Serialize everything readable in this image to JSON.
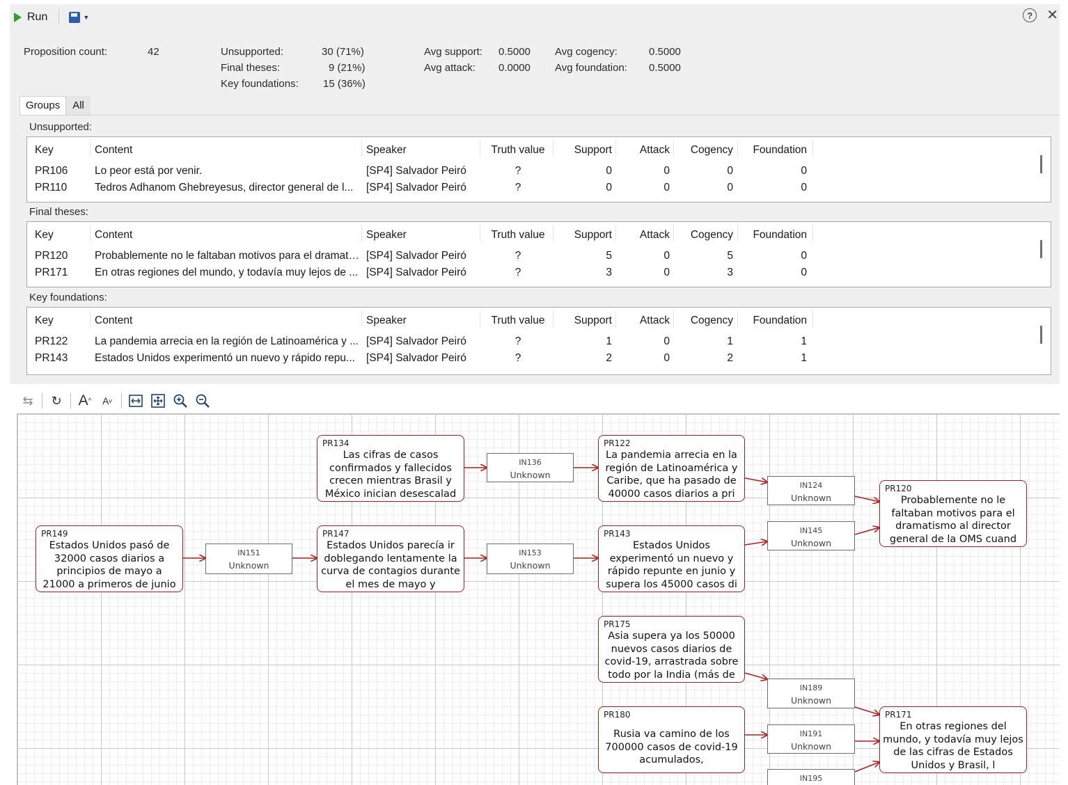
{
  "toolbar": {
    "run_label": "Run"
  },
  "stats": {
    "proposition_count_label": "Proposition count:",
    "proposition_count_value": "42",
    "unsupported_label": "Unsupported:",
    "unsupported_value": "30 (71%)",
    "final_theses_label": "Final theses:",
    "final_theses_value": "9 (21%)",
    "key_foundations_label": "Key foundations:",
    "key_foundations_value": "15 (36%)",
    "avg_support_label": "Avg support:",
    "avg_support_value": "0.5000",
    "avg_attack_label": "Avg attack:",
    "avg_attack_value": "0.0000",
    "avg_cogency_label": "Avg cogency:",
    "avg_cogency_value": "0.5000",
    "avg_foundation_label": "Avg foundation:",
    "avg_foundation_value": "0.5000"
  },
  "tabs": [
    {
      "label": "Groups"
    },
    {
      "label": "All"
    }
  ],
  "columns": [
    "Key",
    "Content",
    "Speaker",
    "Truth value",
    "Support",
    "Attack",
    "Cogency",
    "Foundation"
  ],
  "groups": {
    "unsupported": {
      "label": "Unsupported:",
      "rows": [
        [
          "PR106",
          "Lo peor está por venir.",
          "[SP4] Salvador Peiró",
          "?",
          "0",
          "0",
          "0",
          "0"
        ],
        [
          "PR110",
          "Tedros Adhanom Ghebreyesus, director general de l...",
          "[SP4] Salvador Peiró",
          "?",
          "0",
          "0",
          "0",
          "0"
        ]
      ]
    },
    "final_theses": {
      "label": "Final theses:",
      "rows": [
        [
          "PR120",
          "Probablemente no le faltaban motivos para el dramati...",
          "[SP4] Salvador Peiró",
          "?",
          "5",
          "0",
          "5",
          "0"
        ],
        [
          "PR171",
          "En otras regiones del mundo, y todavía muy lejos de ...",
          "[SP4] Salvador Peiró",
          "?",
          "3",
          "0",
          "3",
          "0"
        ]
      ]
    },
    "key_foundations": {
      "label": "Key foundations:",
      "rows": [
        [
          "PR122",
          "La pandemia arrecia en la región de Latinoamérica y ...",
          "[SP4] Salvador Peiró",
          "?",
          "1",
          "0",
          "1",
          "1"
        ],
        [
          "PR143",
          "Estados Unidos experimentó un nuevo y rápido repu...",
          "[SP4] Salvador Peiró",
          "?",
          "2",
          "0",
          "2",
          "1"
        ]
      ]
    }
  },
  "diagram": {
    "propositions": {
      "pr134": {
        "key": "PR134",
        "text": "Las cifras de casos confirmados y fallecidos crecen mientras Brasil y México inician desescalad"
      },
      "pr122": {
        "key": "PR122",
        "text": "La pandemia arrecia en la región de Latinoamérica y Caribe, que ha pasado de 40000 casos diarios a pri"
      },
      "pr120": {
        "key": "PR120",
        "text": "Probablemente no le faltaban motivos para el dramatismo al director general de la OMS cuand"
      },
      "pr149": {
        "key": "PR149",
        "text": "Estados Unidos pasó de 32000 casos diarios a principios de mayo a 21000 a primeros de junio"
      },
      "pr147": {
        "key": "PR147",
        "text": "Estados Unidos parecía ir doblegando lentamente la curva de contagios durante el mes de mayo y"
      },
      "pr143": {
        "key": "PR143",
        "text": "Estados Unidos experimentó un nuevo y rápido repunte en junio y supera los 45000 casos di"
      },
      "pr175": {
        "key": "PR175",
        "text": "Asia supera ya los 50000 nuevos casos diarios de covid-19, arrastrada sobre todo por la India (más de"
      },
      "pr180": {
        "key": "PR180",
        "text": "Rusia va camino de los 700000 casos de covid-19 acumulados,"
      },
      "pr171": {
        "key": "PR171",
        "text": "En otras regiones del mundo, y todavía muy lejos de las cifras de Estados Unidos y Brasil, l"
      }
    },
    "inferences": {
      "in136": {
        "key": "IN136",
        "value": "Unknown"
      },
      "in124": {
        "key": "IN124",
        "value": "Unknown"
      },
      "in145": {
        "key": "IN145",
        "value": "Unknown"
      },
      "in151": {
        "key": "IN151",
        "value": "Unknown"
      },
      "in153": {
        "key": "IN153",
        "value": "Unknown"
      },
      "in189": {
        "key": "IN189",
        "value": "Unknown"
      },
      "in191": {
        "key": "IN191",
        "value": "Unknown"
      },
      "in195": {
        "key": "IN195",
        "value": ""
      }
    },
    "colors": {
      "proposition_border": "#a51d1d",
      "inference_border": "#6c6c6c",
      "arrow": "#b01e1e"
    }
  }
}
